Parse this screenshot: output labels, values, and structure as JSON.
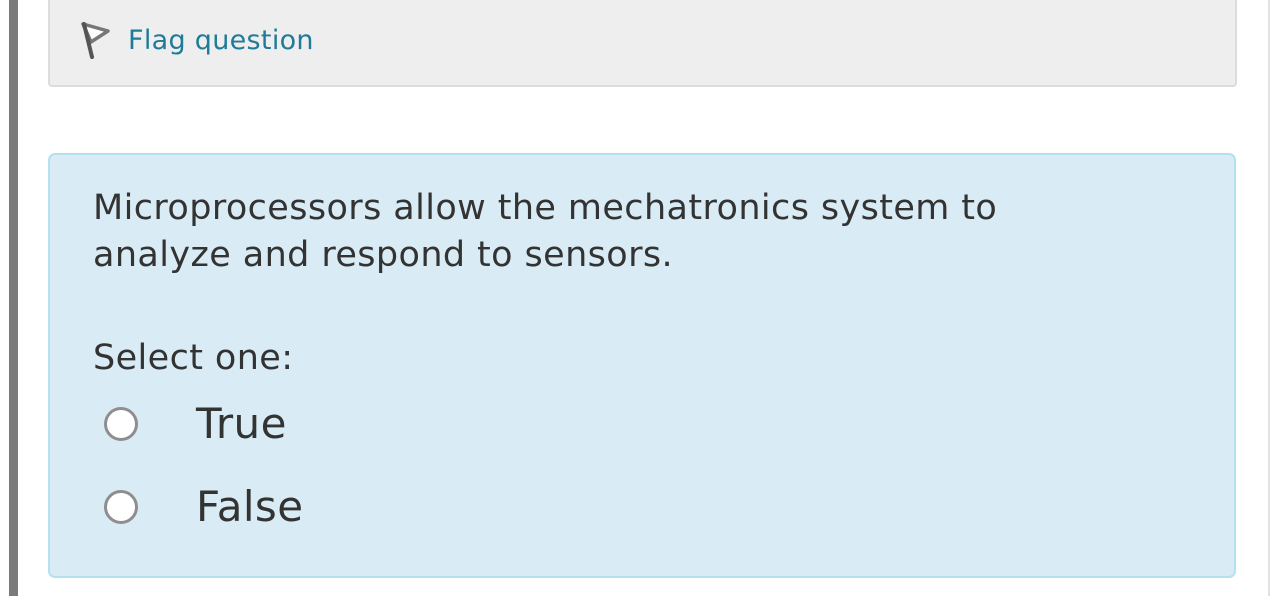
{
  "info": {
    "flag_label": "Flag question",
    "flag_icon": "flag-outline-icon"
  },
  "question": {
    "text": "Microprocessors allow the mechatronics system to analyze and respond to sensors.",
    "prompt": "Select one:",
    "options": [
      {
        "label": "True",
        "selected": false
      },
      {
        "label": "False",
        "selected": false
      }
    ]
  },
  "colors": {
    "link": "#1f7b98",
    "question_bg": "#d9ecf5",
    "question_border": "#b5e1ee",
    "info_bg": "#eeeeee"
  }
}
